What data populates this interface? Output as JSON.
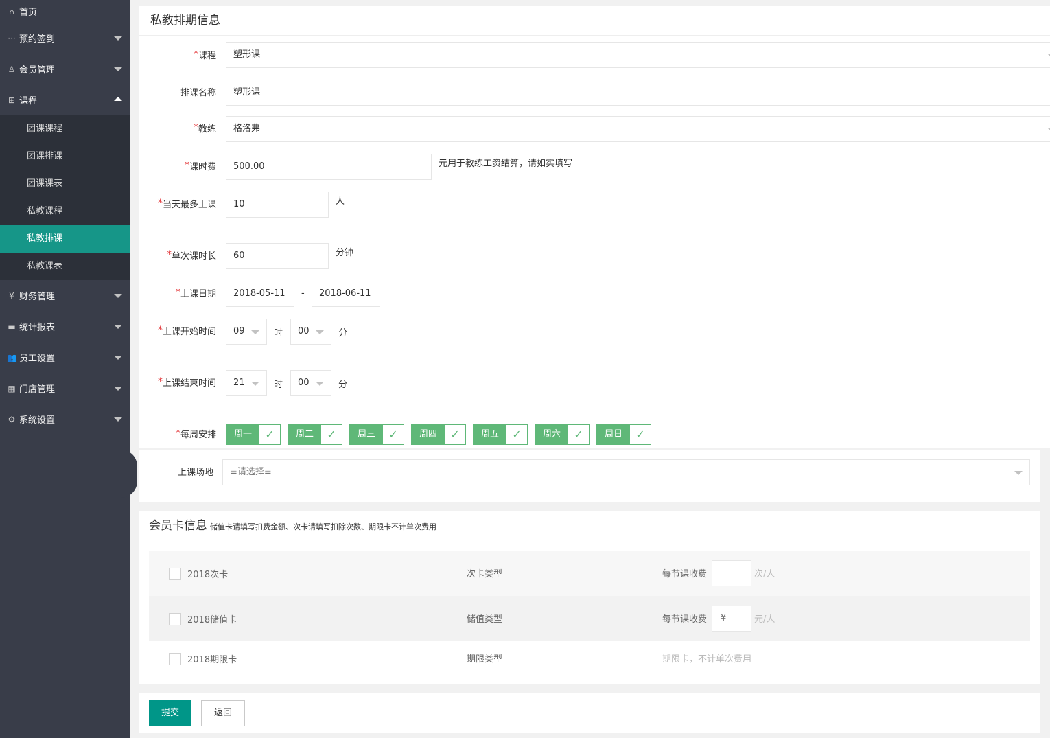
{
  "sidebar": {
    "home": "首页",
    "items": [
      {
        "label": "预约签到",
        "icon": "dots-icon"
      },
      {
        "label": "会员管理",
        "icon": "user-icon"
      },
      {
        "label": "课程",
        "icon": "grid-icon"
      }
    ],
    "course_sub": [
      "团课课程",
      "团课排课",
      "团课课表",
      "私教课程",
      "私教排课",
      "私教课表"
    ],
    "items2": [
      {
        "label": "财务管理",
        "icon": "yen-icon"
      },
      {
        "label": "统计报表",
        "icon": "chart-icon"
      },
      {
        "label": "员工设置",
        "icon": "users-icon"
      },
      {
        "label": "门店管理",
        "icon": "store-icon"
      },
      {
        "label": "系统设置",
        "icon": "gear-icon"
      }
    ]
  },
  "form": {
    "title": "私教排期信息",
    "course_label": "课程",
    "course_value": "塑形课",
    "schedule_name_label": "排课名称",
    "schedule_name_value": "塑形课",
    "coach_label": "教练",
    "coach_value": "格洛弗",
    "fee_label": "课时费",
    "fee_value": "500.00",
    "fee_hint": "元用于教练工资结算，请如实填写",
    "max_label": "当天最多上课",
    "max_value": "10",
    "max_unit": "人",
    "duration_label": "单次课时长",
    "duration_value": "60",
    "duration_unit": "分钟",
    "date_label": "上课日期",
    "date_start": "2018-05-11",
    "date_sep": "-",
    "date_end": "2018-06-11",
    "start_time_label": "上课开始时间",
    "start_hour": "09",
    "start_minute": "00",
    "end_time_label": "上课结束时间",
    "end_hour": "21",
    "end_minute": "00",
    "hour_unit": "时",
    "minute_unit": "分",
    "weekly_label": "每周安排",
    "days": [
      "周一",
      "周二",
      "周三",
      "周四",
      "周五",
      "周六",
      "周日"
    ],
    "check_mark": "✓",
    "venue_label": "上课场地",
    "venue_placeholder": "≡请选择≡"
  },
  "cards": {
    "title": "会员卡信息",
    "hint": "储值卡请填写扣费金额、次卡请填写扣除次数、期限卡不计单次费用",
    "fee_label": "每节课收费",
    "rows": [
      {
        "name": "2018次卡",
        "type": "次卡类型",
        "fee": "",
        "unit": "次/人"
      },
      {
        "name": "2018储值卡",
        "type": "储值类型",
        "fee": "¥",
        "unit": "元/人"
      },
      {
        "name": "2018期限卡",
        "type": "期限类型",
        "note": "期限卡，不计单次费用"
      }
    ]
  },
  "actions": {
    "submit": "提交",
    "back": "返回"
  },
  "colors": {
    "sidebar_bg": "#393d49",
    "sub_bg": "#2c3039",
    "accent": "#009688",
    "active_sub": "#169688",
    "day_green": "#5fb878",
    "required": "#e4393c"
  }
}
